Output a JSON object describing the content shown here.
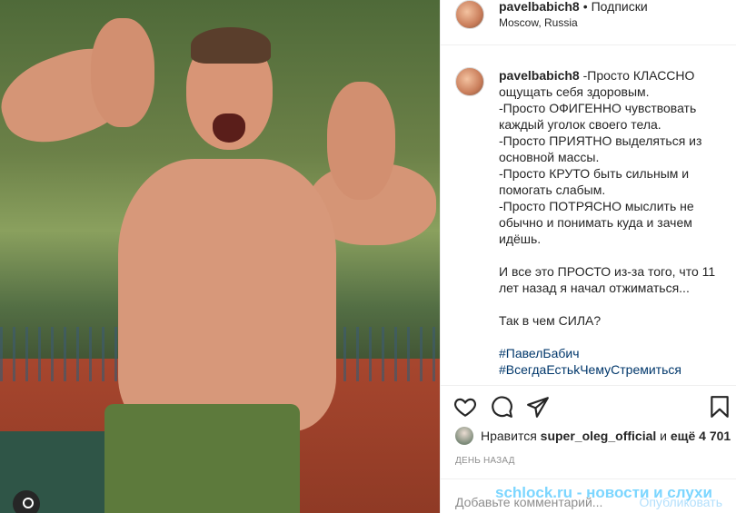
{
  "post": {
    "username": "pavelbabich8",
    "follow_sep": "•",
    "follow_label": "Подписки",
    "location": "Moscow, Russia"
  },
  "caption": {
    "username": "pavelbabich8",
    "lines": [
      " -Просто КЛАССНО ощущать себя здоровым.",
      "-Просто ОФИГЕННО чувствовать каждый уголок своего тела.",
      "-Просто ПРИЯТНО выделяться из основной массы.",
      "-Просто КРУТО быть сильным и помогать слабым.",
      "-Просто ПОТРЯСНО мыслить не обычно и понимать куда и зачем идёшь.",
      "",
      "И все это ПРОСТО из-за того, что 11 лет назад я начал отжиматься...",
      "",
      "Так в чем СИЛА?",
      ""
    ],
    "hashtags": [
      "#ПавелБабич",
      "#ВсегдаЕстьkЧемуСтремиться"
    ]
  },
  "likes": {
    "prefix": "Нравится",
    "user": "super_oleg_official",
    "mid": "и",
    "count": "ещё 4 701"
  },
  "timestamp": "ДЕНЬ НАЗАД",
  "comment": {
    "placeholder": "Добавьте комментарий...",
    "publish": "Опубликовать"
  },
  "watermark": "schlock.ru - новости и слухи",
  "icons": {
    "like": "heart-icon",
    "comment": "comment-icon",
    "share": "share-icon",
    "save": "bookmark-icon"
  },
  "colors": {
    "link": "#00376b",
    "muted": "#8e8e8e",
    "publish_disabled": "#b2dffc",
    "watermark": "#50c8ff"
  }
}
